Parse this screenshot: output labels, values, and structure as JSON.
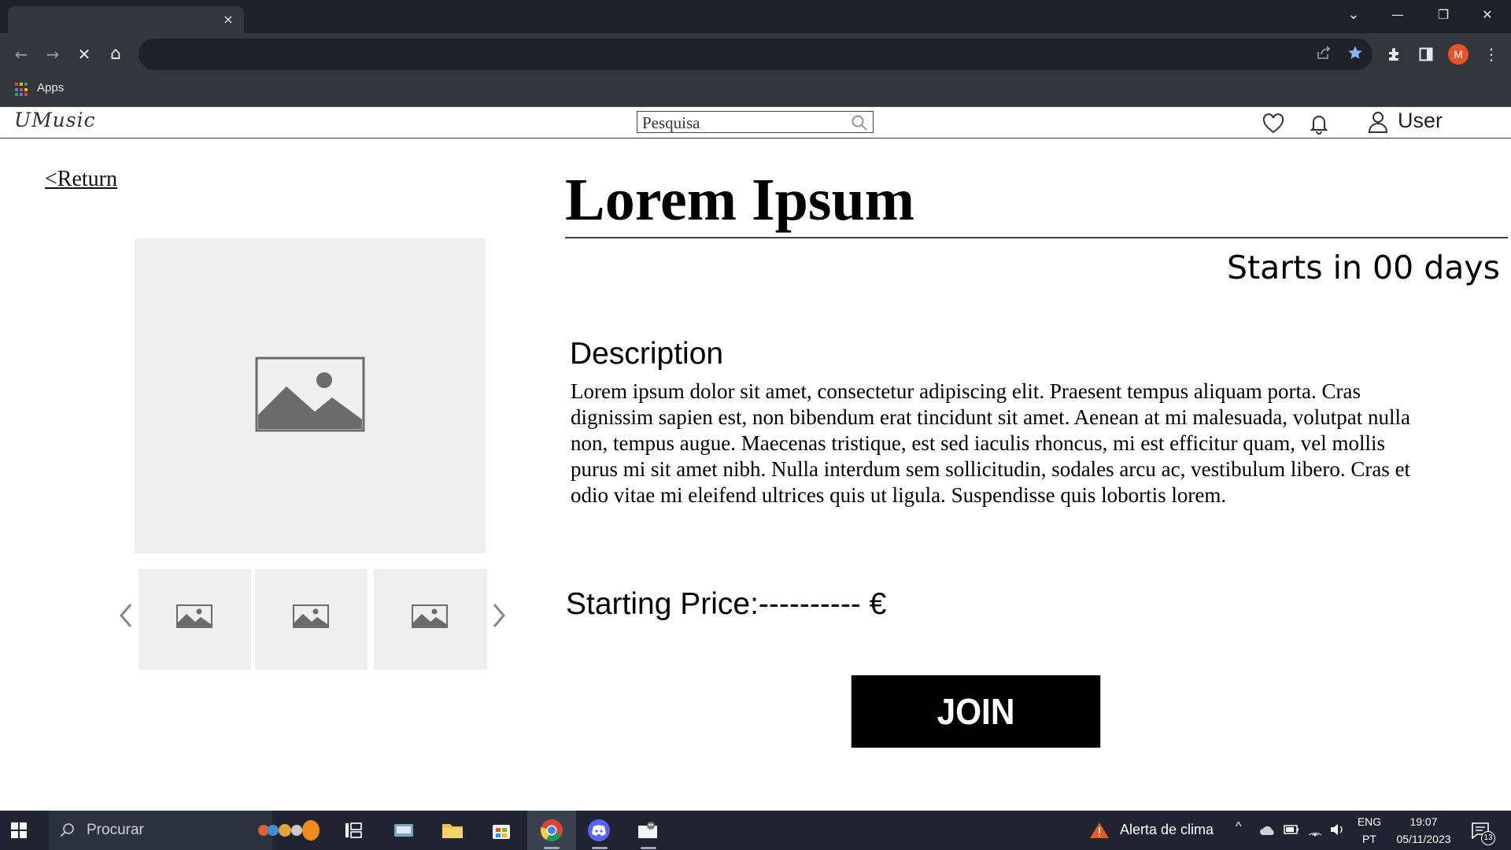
{
  "browser": {
    "tab_close": "×",
    "bookmarks": {
      "apps_label": "Apps"
    },
    "profile_initial": "M",
    "window_controls": {
      "tabs": "⌄",
      "minimize": "—",
      "restore": "❐",
      "close": "✕"
    },
    "nav": {
      "back": "←",
      "forward": "→",
      "stop": "✕",
      "home": "⌂"
    }
  },
  "site": {
    "logo": "UMusic",
    "search_placeholder": "Pesquisa",
    "user_label": "User"
  },
  "event": {
    "return_label": "<Return",
    "title": "Lorem Ipsum",
    "starts_in": "Starts in 00 days",
    "description_heading": "Description",
    "description": "Lorem ipsum dolor sit amet, consectetur adipiscing elit. Praesent tempus aliquam porta. Cras dignissim sapien est, non bibendum erat tincidunt sit amet. Aenean at mi malesuada, volutpat nulla non, tempus augue. Maecenas tristique, est sed iaculis rhoncus, mi est efficitur quam, vel mollis purus mi sit amet nibh. Nulla interdum sem sollicitudin, sodales arcu ac, vestibulum libero. Cras et odio vitae mi eleifend ultrices quis ut ligula. Suspendisse quis lobortis lorem.",
    "starting_price": "Starting Price:---------- €",
    "join_label": "JOIN"
  },
  "taskbar": {
    "search_label": "Procurar",
    "weather_alert": "Alerta de clima",
    "lang_top": "ENG",
    "lang_bottom": "PT",
    "time": "19:07",
    "date": "05/11/2023",
    "notification_count": "13"
  },
  "colors": {
    "chrome_dark": "#202124",
    "chrome_toolbar": "#35363a",
    "bookmark_star": "#8ab4f8",
    "profile": "#e8532b",
    "join_button": "#000000",
    "placeholder_gray": "#efefef",
    "taskbar": "#1f2430"
  }
}
